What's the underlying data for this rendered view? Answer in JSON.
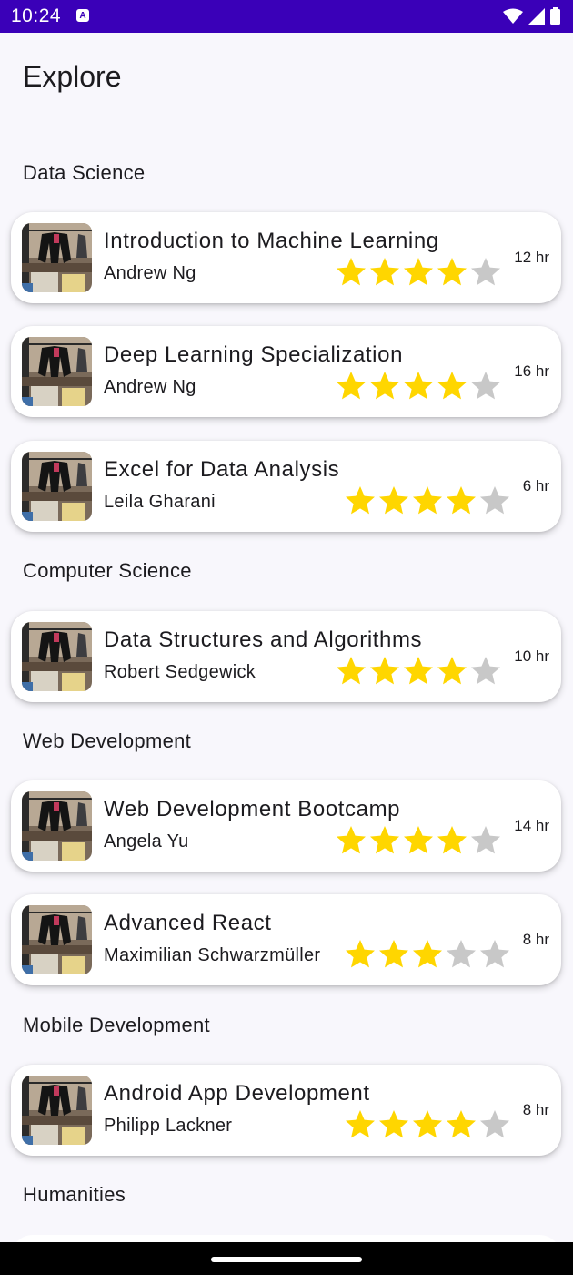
{
  "status_bar": {
    "time": "10:24",
    "notification_letter": "A"
  },
  "header": {
    "title": "Explore"
  },
  "colors": {
    "status_bar": "#3a00b8",
    "star_filled": "#ffd600",
    "star_empty": "#c8c8c8",
    "background": "#f8f7fc"
  },
  "sections": [
    {
      "title": "Data Science",
      "courses": [
        {
          "title": "Introduction to Machine Learning",
          "author": "Andrew Ng",
          "rating": 4,
          "duration": "12 hr"
        },
        {
          "title": "Deep Learning Specialization",
          "author": "Andrew Ng",
          "rating": 4,
          "duration": "16 hr"
        },
        {
          "title": "Excel for Data Analysis",
          "author": "Leila Gharani",
          "rating": 4,
          "duration": "6 hr"
        }
      ]
    },
    {
      "title": "Computer Science",
      "courses": [
        {
          "title": "Data Structures and Algorithms",
          "author": "Robert Sedgewick",
          "rating": 4,
          "duration": "10 hr"
        }
      ]
    },
    {
      "title": "Web Development",
      "courses": [
        {
          "title": "Web Development Bootcamp",
          "author": "Angela Yu",
          "rating": 4,
          "duration": "14 hr"
        },
        {
          "title": "Advanced React",
          "author": "Maximilian Schwarzmüller",
          "rating": 3,
          "duration": "8 hr"
        }
      ]
    },
    {
      "title": "Mobile Development",
      "courses": [
        {
          "title": "Android App Development",
          "author": "Philipp Lackner",
          "rating": 4,
          "duration": "8 hr"
        }
      ]
    },
    {
      "title": "Humanities",
      "courses": []
    }
  ]
}
